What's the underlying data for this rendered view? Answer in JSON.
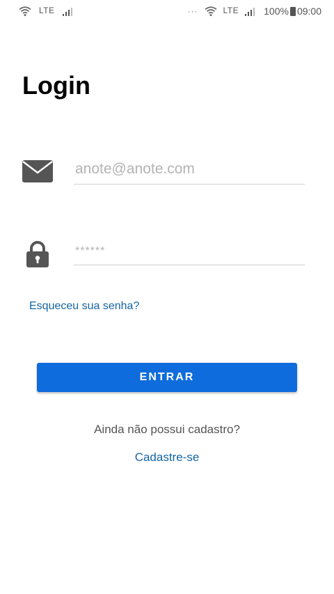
{
  "status_bar": {
    "left_network": "LTE",
    "right_dots": "···",
    "right_network": "LTE",
    "battery": "100%",
    "time": "09:00",
    "icons": [
      "wifi-icon",
      "signal-icon",
      "battery-icon"
    ]
  },
  "login": {
    "title": "Login",
    "email_placeholder": "anote@anote.com",
    "email_value": "",
    "password_placeholder": "******",
    "password_value": "",
    "forgot_password": "Esqueceu sua senha?",
    "submit_label": "ENTRAR",
    "no_account_text": "Ainda não possui cadastro?",
    "signup_link": "Cadastre-se"
  },
  "colors": {
    "accent": "#0f6cdc",
    "link": "#1464a5",
    "icon": "#555555",
    "placeholder": "#b3b3b3"
  }
}
